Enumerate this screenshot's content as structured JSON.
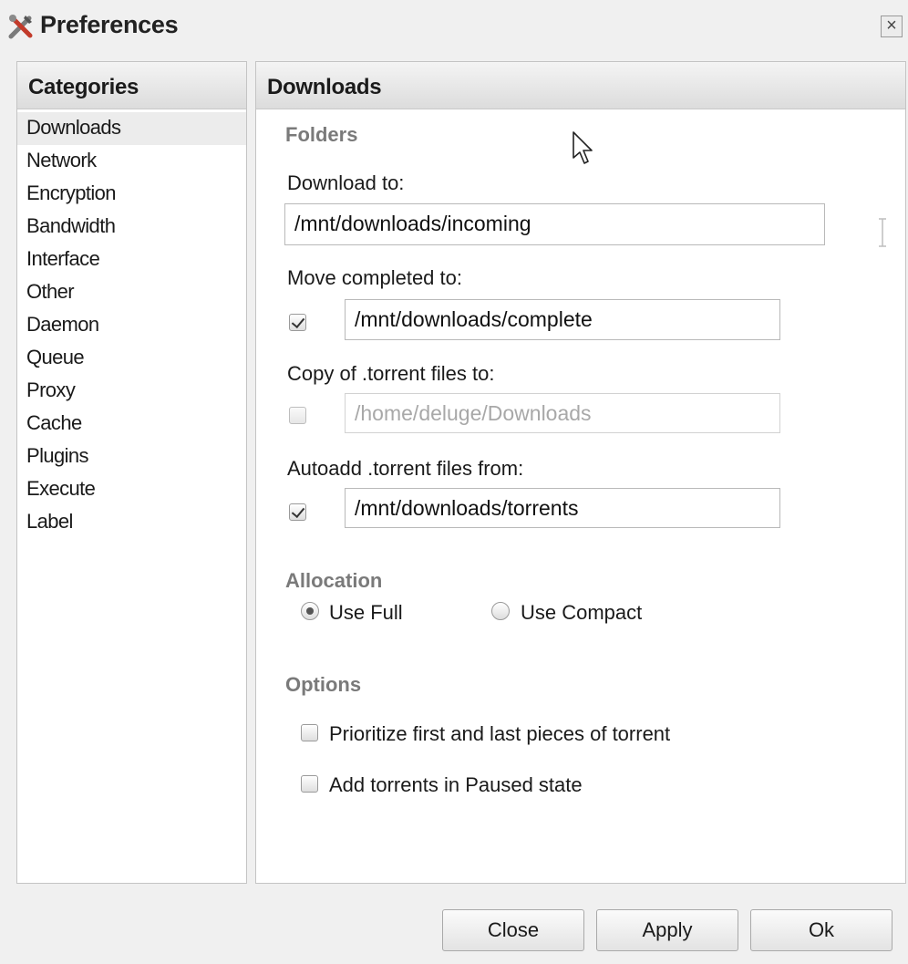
{
  "window": {
    "title": "Preferences",
    "close_glyph": "×"
  },
  "categories": {
    "header": "Categories",
    "items": [
      "Downloads",
      "Network",
      "Encryption",
      "Bandwidth",
      "Interface",
      "Other",
      "Daemon",
      "Queue",
      "Proxy",
      "Cache",
      "Plugins",
      "Execute",
      "Label"
    ],
    "selected": "Downloads"
  },
  "main": {
    "header": "Downloads",
    "folders": {
      "title": "Folders",
      "download_to": {
        "label": "Download to:",
        "value": "/mnt/downloads/incoming"
      },
      "move_completed": {
        "label": "Move completed to:",
        "checked": true,
        "value": "/mnt/downloads/complete"
      },
      "copy_torrent": {
        "label": "Copy of .torrent files to:",
        "checked": false,
        "value": "/home/deluge/Downloads"
      },
      "autoadd": {
        "label": "Autoadd .torrent files from:",
        "checked": true,
        "value": "/mnt/downloads/torrents"
      }
    },
    "allocation": {
      "title": "Allocation",
      "use_full": "Use Full",
      "use_compact": "Use Compact",
      "selected": "Use Full"
    },
    "options": {
      "title": "Options",
      "prioritize": {
        "label": "Prioritize first and last pieces of torrent",
        "checked": false
      },
      "add_paused": {
        "label": "Add torrents in Paused state",
        "checked": false
      }
    }
  },
  "buttons": {
    "close": "Close",
    "apply": "Apply",
    "ok": "Ok"
  },
  "icons": {
    "title_icon": "tools-icon",
    "cursor": "mouse-pointer-icon",
    "text_cursor": "text-cursor-icon"
  },
  "colors": {
    "panel_header": "#dcdcdc",
    "section_label": "#7a7a7a",
    "window_bg": "#f0f0f0"
  }
}
